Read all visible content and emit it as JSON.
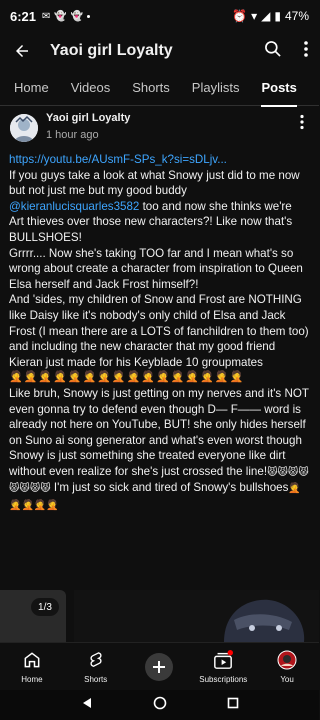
{
  "status_bar": {
    "time": "6:21",
    "battery": "47%"
  },
  "header": {
    "title": "Yaoi girl Loyalty"
  },
  "tabs": [
    {
      "label": "Home"
    },
    {
      "label": "Videos"
    },
    {
      "label": "Shorts"
    },
    {
      "label": "Playlists"
    },
    {
      "label": "Posts",
      "active": true
    }
  ],
  "post": {
    "author": "Yaoi girl Loyalty",
    "time": "1 hour ago",
    "link": "https://youtu.be/AUsmF-SPs_k?si=sDLjv...",
    "mention": "@kieranlucisquarles3582",
    "text_a": "If you guys take a look at what Snowy just did to me now but not just me but my good buddy ",
    "text_b": " too and now she thinks we're Art thieves over those new characters?! Like now that's BULLSHOES!",
    "text_c": "Grrrr.... Now she's taking TOO far and I mean what's so wrong about create a character from inspiration to Queen Elsa herself and Jack Frost himself?!",
    "text_d": "And 'sides, my children of Snow and Frost are NOTHING like Daisy like it's nobody's only child of Elsa and Jack Frost (I mean there are a LOTS of fanchildren to them too) and including the new character that my good friend Kieran just made for his Keyblade 10 groupmates",
    "emoji_row": "🤦🤦🤦🤦🤦🤦🤦🤦🤦🤦🤦🤦🤦🤦🤦🤦",
    "text_e": "Like bruh, Snowy is just getting on my nerves and it's NOT even gonna try to defend even though D— F—— word is already not here on YouTube, BUT! she only hides herself on Suno ai song generator and what's even worst though Snowy is just something she treated everyone like dirt without even realize for she's just crossed the line!",
    "emoji_cats": "😾😾😾😾😾😾😾😾",
    "text_f": " I'm just so sick and tired of Snowy's bullshoes",
    "emoji_end": "🤦🤦🤦🤦🤦",
    "image_counter": "1/3"
  },
  "bottom_nav": [
    {
      "label": "Home",
      "icon": "home-icon"
    },
    {
      "label": "Shorts",
      "icon": "shorts-icon"
    },
    {
      "label": "",
      "icon": "create-icon"
    },
    {
      "label": "Subscriptions",
      "icon": "subscriptions-icon"
    },
    {
      "label": "You",
      "icon": "you-avatar-icon"
    }
  ],
  "colors": {
    "background": "#0f0f0f",
    "link": "#3ea6ff",
    "text": "#f1f1f1"
  }
}
